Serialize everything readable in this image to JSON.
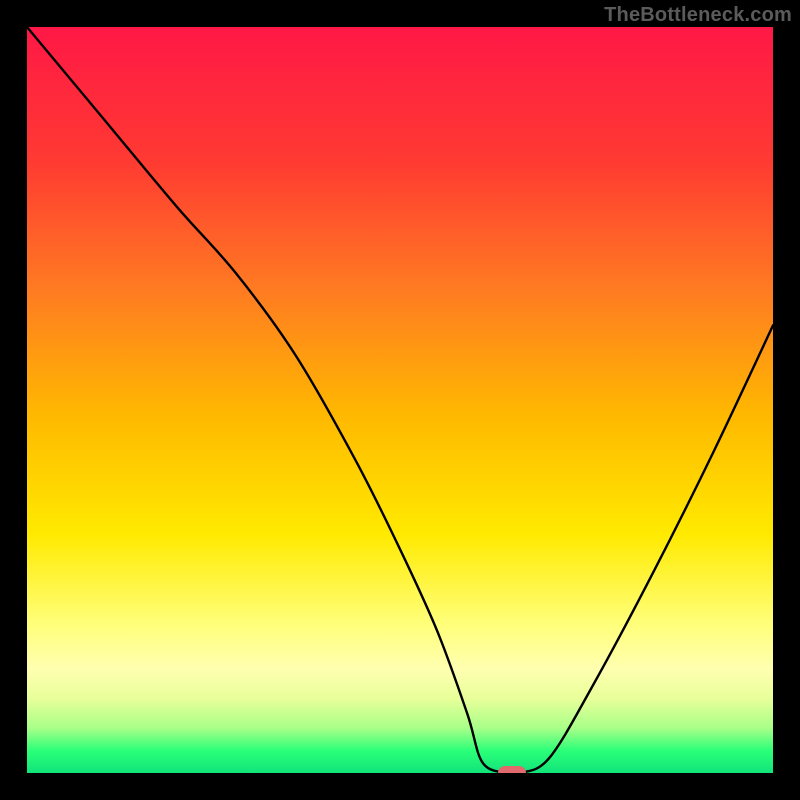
{
  "credit": "TheBottleneck.com",
  "colors": {
    "frame": "#000000",
    "marker": "#e26a6c",
    "curve": "#000000",
    "gradient_top": "#ff1846",
    "gradient_bottom": "#11e47a"
  },
  "chart_data": {
    "type": "line",
    "title": "",
    "xlabel": "",
    "ylabel": "",
    "xlim": [
      0,
      100
    ],
    "ylim": [
      0,
      100
    ],
    "series": [
      {
        "name": "bottleneck-curve",
        "x": [
          0,
          10,
          20,
          28,
          36,
          44,
          50,
          55,
          59,
          61,
          64,
          66,
          70,
          76,
          84,
          92,
          100
        ],
        "y": [
          100,
          88,
          76,
          67,
          56,
          42,
          30,
          19,
          8,
          1.5,
          0,
          0,
          2,
          12,
          27,
          43,
          60
        ]
      }
    ],
    "marker": {
      "x": 65,
      "y": 0
    },
    "grid": false,
    "legend": false
  }
}
